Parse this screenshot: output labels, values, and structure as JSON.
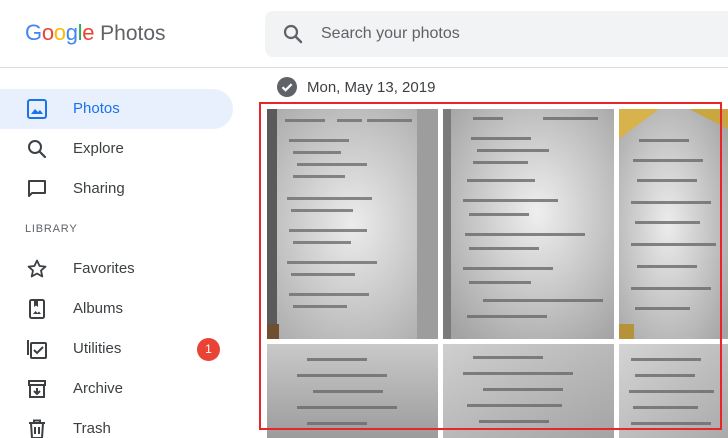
{
  "header": {
    "logo_letters": [
      {
        "ch": "G",
        "color": "#4285f4"
      },
      {
        "ch": "o",
        "color": "#ea4335"
      },
      {
        "ch": "o",
        "color": "#fbbc05"
      },
      {
        "ch": "g",
        "color": "#4285f4"
      },
      {
        "ch": "l",
        "color": "#34a853"
      },
      {
        "ch": "e",
        "color": "#ea4335"
      }
    ],
    "product": "Photos",
    "search_placeholder": "Search your photos"
  },
  "sidebar": {
    "items": [
      {
        "label": "Photos",
        "icon": "photo-icon",
        "active": true
      },
      {
        "label": "Explore",
        "icon": "search-icon"
      },
      {
        "label": "Sharing",
        "icon": "chat-bubble-icon"
      }
    ],
    "library_label": "LIBRARY",
    "library_items": [
      {
        "label": "Favorites",
        "icon": "star-icon"
      },
      {
        "label": "Albums",
        "icon": "album-icon"
      },
      {
        "label": "Utilities",
        "icon": "utilities-icon",
        "badge": "1"
      },
      {
        "label": "Archive",
        "icon": "archive-icon"
      },
      {
        "label": "Trash",
        "icon": "trash-icon"
      }
    ]
  },
  "main": {
    "date_label": "Mon, May 13, 2019",
    "photos": [
      {
        "label": "photo-1"
      },
      {
        "label": "photo-2"
      },
      {
        "label": "photo-3"
      },
      {
        "label": "photo-4"
      },
      {
        "label": "photo-5"
      },
      {
        "label": "photo-6"
      }
    ]
  },
  "colors": {
    "accent": "#1a73e8",
    "active_bg": "#e8f0fe",
    "badge": "#ea4335",
    "selection_outline": "#e8262a"
  }
}
